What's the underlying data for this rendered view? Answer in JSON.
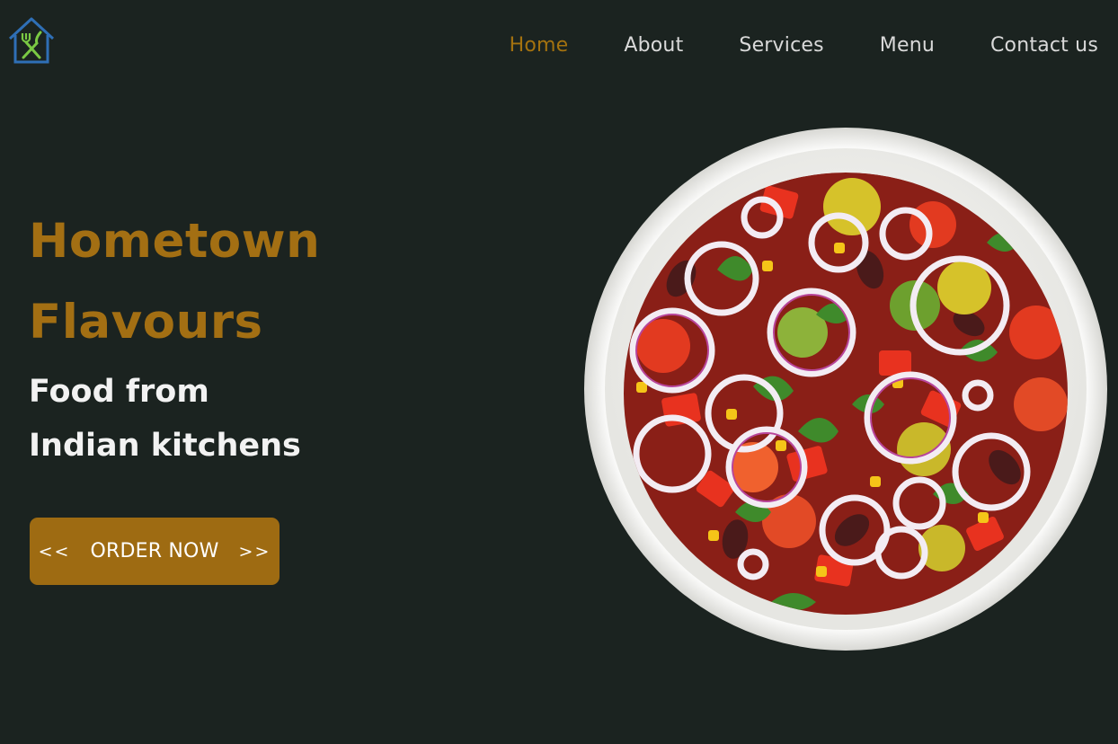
{
  "header": {
    "logo_icon": "house-fork-knife-icon",
    "nav": [
      {
        "label": "Home",
        "active": true
      },
      {
        "label": "About",
        "active": false
      },
      {
        "label": "Services",
        "active": false
      },
      {
        "label": "Menu",
        "active": false
      },
      {
        "label": "Contact us",
        "active": false
      }
    ]
  },
  "hero": {
    "title_line1": "Hometown",
    "title_line2": "Flavours",
    "subtitle_line1": "Food from",
    "subtitle_line2": "Indian kitchens",
    "cta": {
      "left_chevrons": "<<",
      "label": "ORDER NOW",
      "right_chevrons": ">>"
    }
  },
  "image": {
    "icon": "salad-bowl-image"
  },
  "colors": {
    "background": "#1b2320",
    "accent": "#a36f13",
    "nav_text": "#d9d9d9",
    "button": "#9e6b12"
  }
}
